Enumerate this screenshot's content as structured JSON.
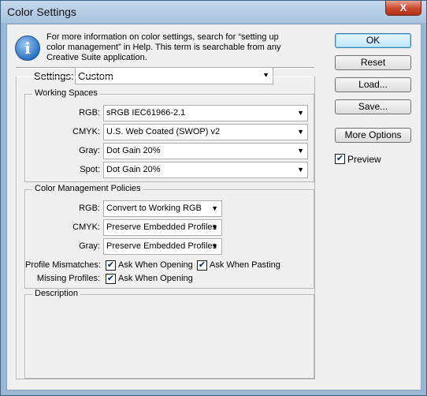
{
  "window": {
    "title": "Color Settings",
    "close_glyph": "X"
  },
  "info": {
    "icon": "i",
    "text": "For more information on color settings, search for “setting up color management” in Help. This term is searchable from any Creative Suite application."
  },
  "settings": {
    "label": "Settings:",
    "value": "Custom"
  },
  "working_spaces": {
    "title": "Working Spaces",
    "rgb_label": "RGB:",
    "rgb_value": "sRGB IEC61966-2.1",
    "cmyk_label": "CMYK:",
    "cmyk_value": "U.S. Web Coated (SWOP) v2",
    "gray_label": "Gray:",
    "gray_value": "Dot Gain 20%",
    "spot_label": "Spot:",
    "spot_value": "Dot Gain 20%"
  },
  "policies": {
    "title": "Color Management Policies",
    "rgb_label": "RGB:",
    "rgb_value": "Convert to Working RGB",
    "cmyk_label": "CMYK:",
    "cmyk_value": "Preserve Embedded Profiles",
    "gray_label": "Gray:",
    "gray_value": "Preserve Embedded Profiles",
    "mismatch_label": "Profile Mismatches:",
    "ask_opening": "Ask When Opening",
    "ask_opening_checked": true,
    "ask_pasting": "Ask When Pasting",
    "ask_pasting_checked": true,
    "missing_label": "Missing Profiles:",
    "missing_ask_opening": "Ask When Opening",
    "missing_ask_opening_checked": true
  },
  "description": {
    "title": "Description"
  },
  "buttons": {
    "ok": "OK",
    "reset": "Reset",
    "load": "Load...",
    "save": "Save...",
    "more_options": "More Options"
  },
  "preview": {
    "label": "Preview",
    "checked": true
  },
  "glyphs": {
    "arrow": "▼",
    "check": "✔"
  }
}
